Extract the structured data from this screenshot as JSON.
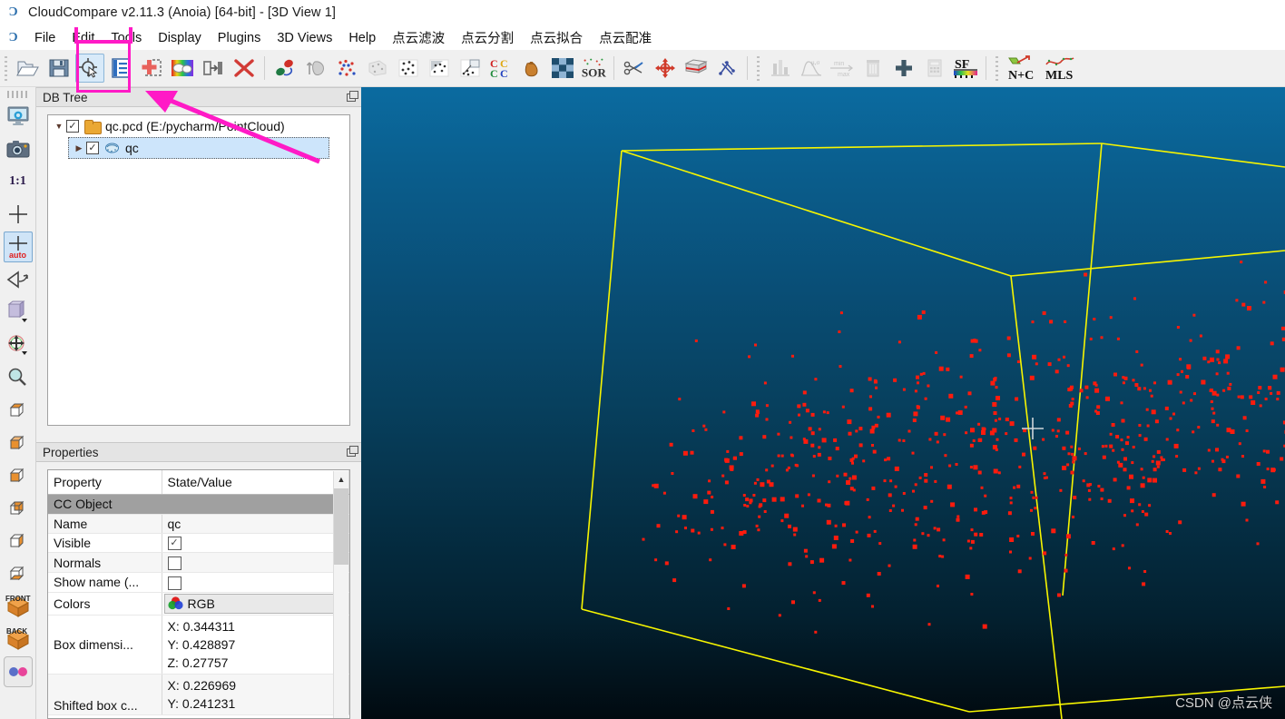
{
  "window": {
    "title": "CloudCompare v2.11.3 (Anoia) [64-bit] - [3D View 1]",
    "logo_glyph": "Ɔ"
  },
  "menubar": {
    "items": [
      {
        "label": "File",
        "name": "menu-file"
      },
      {
        "label": "Edit",
        "name": "menu-edit"
      },
      {
        "label": "Tools",
        "name": "menu-tools"
      },
      {
        "label": "Display",
        "name": "menu-display"
      },
      {
        "label": "Plugins",
        "name": "menu-plugins"
      },
      {
        "label": "3D Views",
        "name": "menu-3d-views"
      },
      {
        "label": "Help",
        "name": "menu-help"
      },
      {
        "label": "点云滤波",
        "name": "menu-point-cloud-filter"
      },
      {
        "label": "点云分割",
        "name": "menu-point-cloud-segmentation"
      },
      {
        "label": "点云拟合",
        "name": "menu-point-cloud-fitting"
      },
      {
        "label": "点云配准",
        "name": "menu-point-cloud-registration"
      }
    ]
  },
  "toolbar": {
    "buttons": [
      {
        "name": "open-file-icon",
        "label": "open"
      },
      {
        "name": "save-file-icon",
        "label": "save"
      },
      {
        "name": "point-picking-icon",
        "label": "point picking",
        "active": true
      },
      {
        "name": "toggle-db-tree-icon",
        "label": "db tree"
      },
      {
        "name": "add-point-icon",
        "label": "add"
      },
      {
        "name": "colors-icon",
        "label": "colors"
      },
      {
        "name": "apply-transform-icon",
        "label": "transform"
      },
      {
        "name": "delete-icon",
        "label": "delete"
      },
      {
        "name": "registration-icon",
        "label": "register"
      },
      {
        "name": "normals-icon",
        "label": "normals"
      },
      {
        "name": "scalar-field-icon",
        "label": "scalar field"
      },
      {
        "name": "mesh-icon",
        "label": "mesh"
      },
      {
        "name": "subsample-icon",
        "label": "subsample"
      },
      {
        "name": "segment-icon",
        "label": "segment"
      },
      {
        "name": "label-icon",
        "label": "label"
      },
      {
        "name": "cloud-cloud-dist-icon",
        "label": "CC"
      },
      {
        "name": "sand-icon",
        "label": "sand"
      },
      {
        "name": "checker-icon",
        "label": "checker"
      },
      {
        "name": "sor-filter-icon",
        "label": "SOR"
      },
      {
        "name": "scissors-icon",
        "label": "scissors"
      },
      {
        "name": "translate-rotate-icon",
        "label": "translate/rotate"
      },
      {
        "name": "cross-section-icon",
        "label": "cross section"
      },
      {
        "name": "sparse-icon",
        "label": "sparse"
      },
      {
        "name": "histogram-icon",
        "label": "histogram"
      },
      {
        "name": "gaussian-icon",
        "label": "gaussian"
      },
      {
        "name": "min-max-icon",
        "label": "min max"
      },
      {
        "name": "trash-icon",
        "label": "trash"
      },
      {
        "name": "plus-icon",
        "label": "plus"
      },
      {
        "name": "calculator-icon",
        "label": "calculator"
      },
      {
        "name": "sf-gradient-icon",
        "label": "SF"
      },
      {
        "name": "normals-plus-curvature-icon",
        "label": "N+C"
      },
      {
        "name": "mls-icon",
        "label": "MLS"
      }
    ]
  },
  "lefttool": {
    "buttons": [
      {
        "name": "display-settings-icon",
        "label": "display settings"
      },
      {
        "name": "camera-snapshot-icon",
        "label": "snapshot"
      },
      {
        "name": "zoom-one-to-one-icon",
        "label": "1:1"
      },
      {
        "name": "set-pivot-icon",
        "label": "pivot"
      },
      {
        "name": "auto-pivot-icon",
        "label": "auto",
        "active": true
      },
      {
        "name": "toggle-view-icon",
        "label": "toggle view"
      },
      {
        "name": "default-view-icon",
        "label": "view direction"
      },
      {
        "name": "move-icon",
        "label": "move"
      },
      {
        "name": "zoom-icon",
        "label": "zoom"
      },
      {
        "name": "view-top-icon",
        "label": "top view"
      },
      {
        "name": "view-bottom-icon",
        "label": "bottom view"
      },
      {
        "name": "view-front-icon",
        "label": "front view"
      },
      {
        "name": "view-back-icon",
        "label": "back view"
      },
      {
        "name": "view-left-icon",
        "label": "left view"
      },
      {
        "name": "view-right-icon",
        "label": "right view"
      },
      {
        "name": "view-iso1-icon",
        "label": "FRONT"
      },
      {
        "name": "view-iso2-icon",
        "label": "BACK"
      },
      {
        "name": "stereo-icon",
        "label": "stereo"
      }
    ],
    "labels": {
      "one_to_one": "1:1",
      "auto": "auto",
      "front": "FRONT",
      "back": "BACK"
    }
  },
  "dbtree": {
    "title": "DB Tree",
    "nodes": [
      {
        "label": "qc.pcd (E:/pycharm/PointCloud)",
        "checked": true,
        "expanded": true,
        "kind": "folder",
        "selected": false
      },
      {
        "label": "qc",
        "checked": true,
        "expanded": false,
        "kind": "cloud",
        "selected": true
      }
    ]
  },
  "properties": {
    "title": "Properties",
    "headers": {
      "property": "Property",
      "value": "State/Value"
    },
    "section": "CC Object",
    "rows": [
      {
        "property": "Name",
        "type": "text",
        "value": "qc"
      },
      {
        "property": "Visible",
        "type": "checkbox",
        "checked": true
      },
      {
        "property": "Normals",
        "type": "checkbox",
        "checked": false
      },
      {
        "property": "Show name (...",
        "type": "checkbox",
        "checked": false
      },
      {
        "property": "Colors",
        "type": "combo",
        "value": "RGB"
      },
      {
        "property": "Box dimensi...",
        "type": "xyz",
        "x": "X: 0.344311",
        "y": "Y: 0.428897",
        "z": "Z: 0.27757"
      },
      {
        "property": "Shifted box c...",
        "type": "xyz2",
        "x": "X: 0.226969",
        "y": "Y: 0.241231"
      }
    ]
  },
  "viewport": {
    "name": "3D View 1",
    "watermark": "CSDN @点云侠",
    "bbox_color": "#f7f500",
    "point_color": "#ff1b0d",
    "cursor": "cross-cursor",
    "background_top": "#0b6ba0",
    "background_bottom": "#010a10",
    "point_count_drawn": 640
  },
  "annotation": {
    "highlight_color": "#ff1ac6",
    "highlight_target": "point-picking-icon",
    "arrow_from": "db-tree-item-qc",
    "arrow_to": "point-picking-icon"
  }
}
